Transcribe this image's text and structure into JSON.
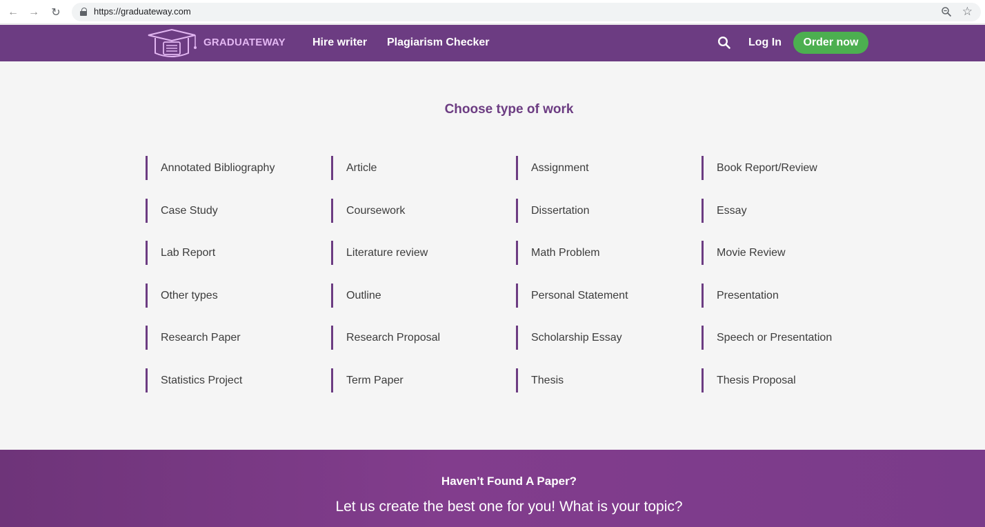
{
  "browser": {
    "url": "https://graduateway.com",
    "back_glyph": "←",
    "forward_glyph": "→",
    "reload_glyph": "↻",
    "star_glyph": "☆"
  },
  "header": {
    "logo_text": "GRADUATEWAY",
    "nav": [
      "Hire writer",
      "Plagiarism Checker"
    ],
    "login_label": "Log In",
    "order_label": "Order now"
  },
  "main": {
    "title": "Choose type of work",
    "work_types": [
      [
        "Annotated Bibliography",
        "Article",
        "Assignment",
        "Book Report/Review"
      ],
      [
        "Case Study",
        "Coursework",
        "Dissertation",
        "Essay"
      ],
      [
        "Lab Report",
        "Literature review",
        "Math Problem",
        "Movie Review"
      ],
      [
        "Other types",
        "Outline",
        "Personal Statement",
        "Presentation"
      ],
      [
        "Research Paper",
        "Research Proposal",
        "Scholarship Essay",
        "Speech or Presentation"
      ],
      [
        "Statistics Project",
        "Term Paper",
        "Thesis",
        "Thesis Proposal"
      ]
    ]
  },
  "banner": {
    "title": "Haven’t Found A Paper?",
    "subtitle": "Let us create the best one for you! What is your topic?"
  },
  "colors": {
    "brand_purple": "#6c3c82",
    "logo_pink": "#e3b7f2",
    "order_green": "#4caf50"
  }
}
